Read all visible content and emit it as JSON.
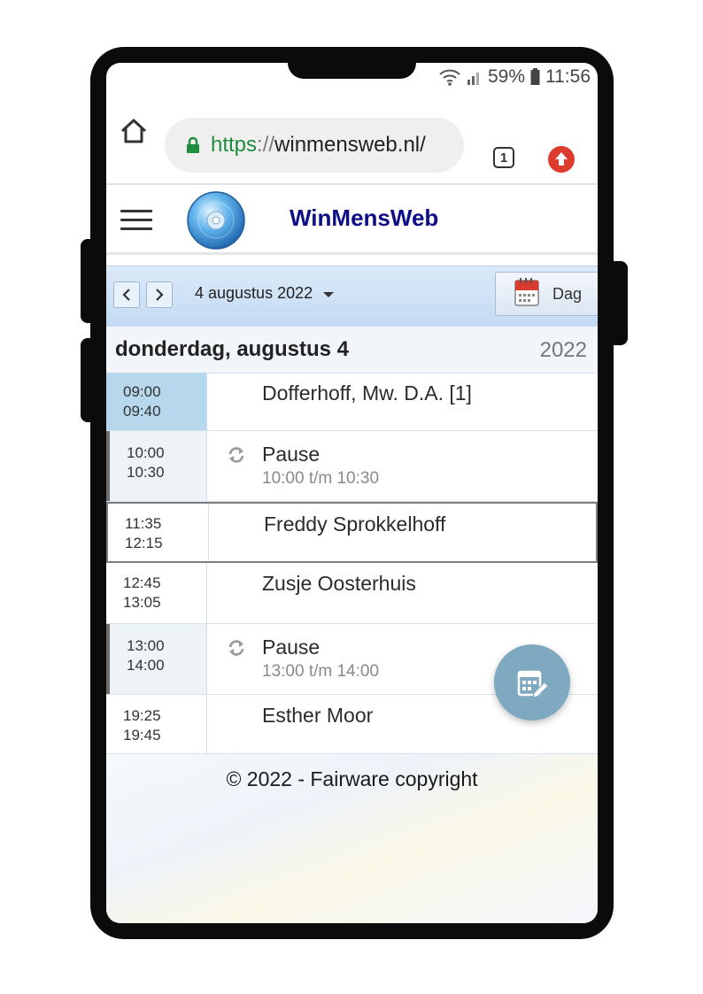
{
  "status_bar": {
    "battery": "59%",
    "time": "11:56"
  },
  "browser": {
    "url_scheme": "https",
    "url_separator": "://",
    "url_host": "winmensweb.nl/",
    "tab_count": "1"
  },
  "app": {
    "title": "WinMensWeb"
  },
  "toolbar": {
    "date_label": "4 augustus 2022",
    "view_label": "Dag"
  },
  "day_header": {
    "day": "donderdag, augustus 4",
    "year": "2022"
  },
  "appointments": [
    {
      "start": "09:00",
      "end": "09:40",
      "title": "Dofferhoff, Mw. D.A. [1]",
      "subtitle": ""
    },
    {
      "start": "10:00",
      "end": "10:30",
      "title": "Pause",
      "subtitle": "10:00 t/m 10:30"
    },
    {
      "start": "11:35",
      "end": "12:15",
      "title": "Freddy Sprokkelhoff",
      "subtitle": ""
    },
    {
      "start": "12:45",
      "end": "13:05",
      "title": "Zusje Oosterhuis",
      "subtitle": ""
    },
    {
      "start": "13:00",
      "end": "14:00",
      "title": "Pause",
      "subtitle": "13:00 t/m 14:00"
    },
    {
      "start": "19:25",
      "end": "19:45",
      "title": "Esther Moor",
      "subtitle": ""
    }
  ],
  "footer": {
    "copyright": "© 2022 - Fairware copyright"
  },
  "colors": {
    "brand": "#0d0d86",
    "url_green": "#1e8e3e",
    "fab": "#7ea9c0",
    "active_slot": "#b6d7ec"
  }
}
